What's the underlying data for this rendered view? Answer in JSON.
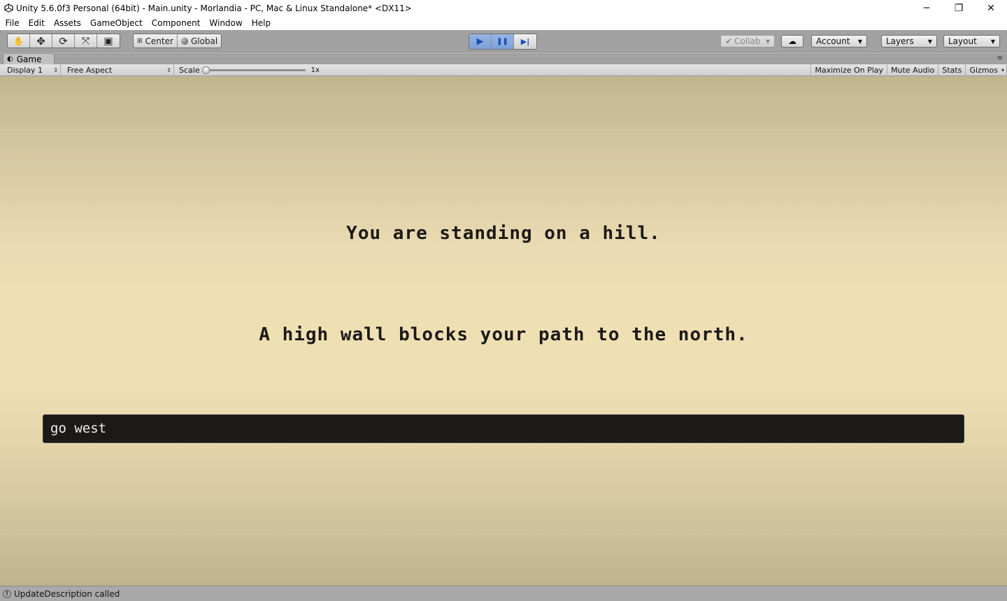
{
  "window": {
    "title": "Unity 5.6.0f3 Personal (64bit) - Main.unity - Morlandia - PC, Mac & Linux Standalone* <DX11>",
    "controls": {
      "minimize": "─",
      "restore": "❐",
      "close": "✕"
    }
  },
  "menu": {
    "items": [
      {
        "label": "File"
      },
      {
        "label": "Edit"
      },
      {
        "label": "Assets"
      },
      {
        "label": "GameObject"
      },
      {
        "label": "Component"
      },
      {
        "label": "Window"
      },
      {
        "label": "Help"
      }
    ]
  },
  "toolbar": {
    "tools": [
      {
        "icon": "hand-icon",
        "glyph": "✋"
      },
      {
        "icon": "move-icon",
        "glyph": "✥"
      },
      {
        "icon": "rotate-icon",
        "glyph": "⟳"
      },
      {
        "icon": "scale-icon",
        "glyph": "⤧"
      },
      {
        "icon": "rect-tool-icon",
        "glyph": "▣"
      }
    ],
    "pivot_label": "Center",
    "space_label": "Global",
    "play": {
      "glyph": "▶",
      "active": true
    },
    "pause": {
      "glyph": "❚❚",
      "active": true
    },
    "step": {
      "glyph": "▶|"
    },
    "collab_label": "Collab",
    "account_label": "Account",
    "layers_label": "Layers",
    "layout_label": "Layout"
  },
  "game_panel": {
    "tab_label": "Game",
    "display_label": "Display 1",
    "aspect_label": "Free Aspect",
    "scale_label": "Scale",
    "scale_value": "1x",
    "maximize_label": "Maximize On Play",
    "mute_label": "Mute Audio",
    "stats_label": "Stats",
    "gizmos_label": "Gizmos"
  },
  "game": {
    "description_line_1": "You are standing on a hill.",
    "description_line_2": "A high wall blocks your path to the north.",
    "command_value": "go west"
  },
  "status": {
    "message": "UpdateDescription called"
  },
  "colors": {
    "game_bg": "#efe0b4",
    "input_bg": "#1b1a19",
    "text_dark": "#1c1a16",
    "play_active": "#7ea1d9"
  }
}
